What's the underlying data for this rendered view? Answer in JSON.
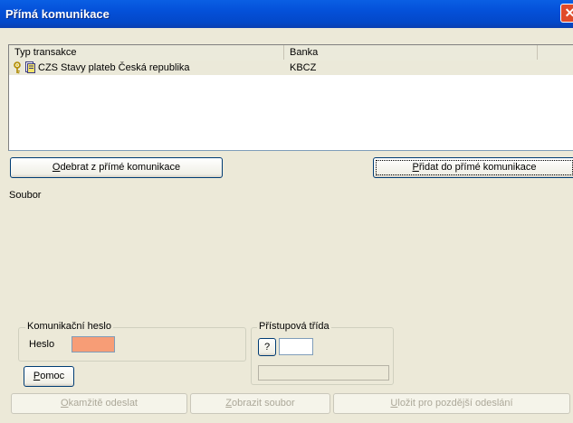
{
  "window": {
    "title": "Přímá komunikace",
    "close_glyph": "✕"
  },
  "list": {
    "columns": [
      "Typ transakce",
      "Banka"
    ],
    "rows": [
      {
        "type": "CZS Stavy plateb Česká republika",
        "bank": "KBCZ",
        "icons": [
          "key-icon",
          "document-icon"
        ]
      }
    ]
  },
  "buttons": {
    "remove": {
      "mnemonic": "O",
      "rest": "debrat z přímé komunikace"
    },
    "add": {
      "mnemonic": "P",
      "rest": "řidat do přímé komunikace"
    },
    "help": {
      "mnemonic": "P",
      "rest": "omoc"
    },
    "send_now": {
      "mnemonic": "O",
      "rest": "kamžitě odeslat"
    },
    "show_file": {
      "mnemonic": "Z",
      "rest": "obrazit soubor"
    },
    "save_later": {
      "mnemonic": "U",
      "rest": "ložit pro pozdější odeslání"
    },
    "question": "?"
  },
  "labels": {
    "file": "Soubor",
    "comm_password_group": "Komunikační heslo",
    "password": "Heslo",
    "access_class_group": "Přístupová třída"
  },
  "colors": {
    "title_bar": "#0450d8",
    "password_field": "#f79d76",
    "dialog_bg": "#ece9d8"
  }
}
